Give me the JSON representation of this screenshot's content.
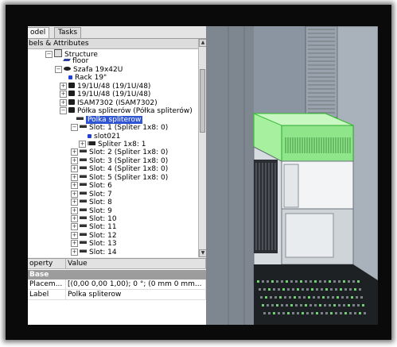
{
  "tabs": [
    {
      "label": "odel"
    },
    {
      "label": "Tasks"
    }
  ],
  "tree_header": "bels & Attributes",
  "tree": [
    {
      "label": "Structure",
      "icon": "structure-icon",
      "expander": "−"
    },
    {
      "label": "floor",
      "icon": "floor-icon",
      "expander": ""
    },
    {
      "label": "Szafa 19x42U",
      "icon": "eye-icon",
      "expander": "−"
    },
    {
      "label": "Rack 19\"",
      "icon": "blue-rack-icon",
      "expander": ""
    },
    {
      "label": "19/1U/48 (19/1U/48)",
      "icon": "rack-icon",
      "expander": "+"
    },
    {
      "label": "19/1U/48 (19/1U/48)",
      "icon": "rack-icon",
      "expander": "+"
    },
    {
      "label": "ISAM7302 (ISAM7302)",
      "icon": "rack-icon",
      "expander": "+"
    },
    {
      "label": "Półka spliterów (Półka spliterów)",
      "icon": "rack-icon",
      "expander": "−"
    },
    {
      "label": "Polka spliterow",
      "icon": "slot-icon",
      "expander": "",
      "selected": true
    },
    {
      "label": "Slot: 1 (Spliter 1x8: 0)",
      "icon": "slot-icon",
      "expander": "−"
    },
    {
      "label": "slot021",
      "icon": "blue-block-icon",
      "expander": ""
    },
    {
      "label": "Spliter 1x8: 1",
      "icon": "splitter-icon",
      "expander": "+"
    },
    {
      "label": "Slot: 2 (Spliter 1x8: 0)",
      "icon": "slot-icon",
      "expander": "+"
    },
    {
      "label": "Slot: 3 (Spliter 1x8: 0)",
      "icon": "slot-icon",
      "expander": "+"
    },
    {
      "label": "Slot: 4 (Spliter 1x8: 0)",
      "icon": "slot-icon",
      "expander": "+"
    },
    {
      "label": "Slot: 5 (Spliter 1x8: 0)",
      "icon": "slot-icon",
      "expander": "+"
    },
    {
      "label": "Slot: 6",
      "icon": "slot-icon",
      "expander": "+"
    },
    {
      "label": "Slot: 7",
      "icon": "slot-icon",
      "expander": "+"
    },
    {
      "label": "Slot: 8",
      "icon": "slot-icon",
      "expander": "+"
    },
    {
      "label": "Slot: 9",
      "icon": "slot-icon",
      "expander": "+"
    },
    {
      "label": "Slot: 10",
      "icon": "slot-icon",
      "expander": "+"
    },
    {
      "label": "Slot: 11",
      "icon": "slot-icon",
      "expander": "+"
    },
    {
      "label": "Slot: 12",
      "icon": "slot-icon",
      "expander": "+"
    },
    {
      "label": "Slot: 13",
      "icon": "slot-icon",
      "expander": "+"
    },
    {
      "label": "Slot: 14",
      "icon": "slot-icon",
      "expander": "+"
    }
  ],
  "properties": {
    "col_property": "operty",
    "col_value": "Value",
    "group": "Base",
    "rows": [
      {
        "name": "Placem...",
        "value": "[(0,00 0,00 1,00); 0 °; (0 mm  0 mm..."
      },
      {
        "name": "Label",
        "value": "Polka spliterow"
      }
    ]
  },
  "colors": {
    "selection": "#2f55d4",
    "highlight_green": "#6fe06f",
    "viewport_bg": "#8c96a2"
  }
}
